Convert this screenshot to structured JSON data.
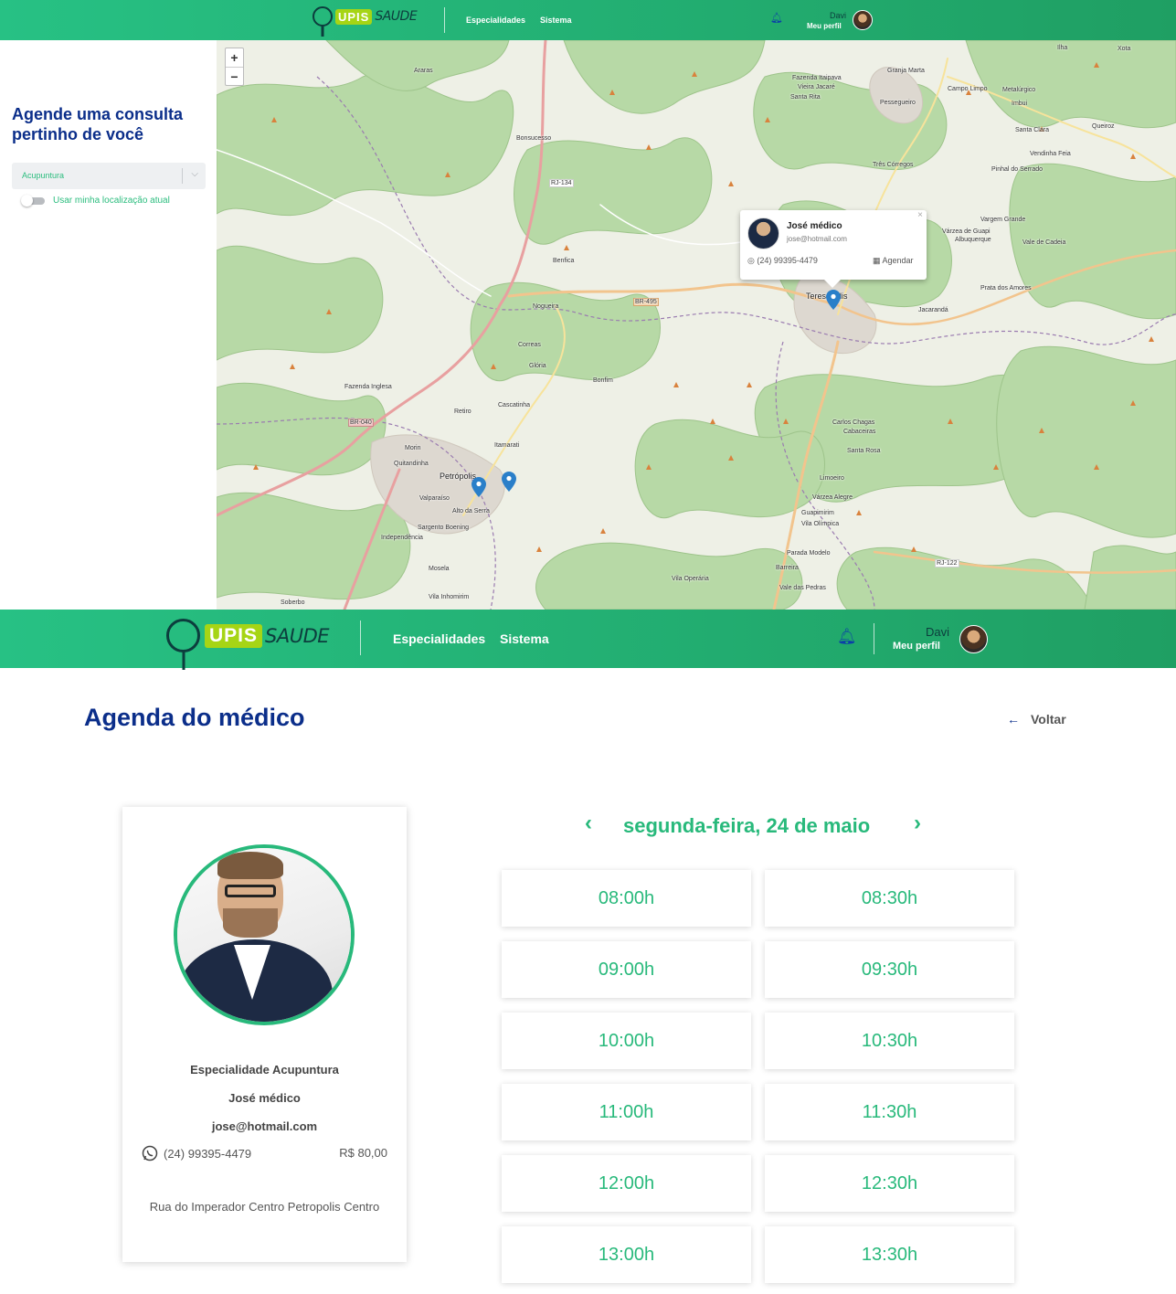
{
  "header_small": {
    "logo_upis": "UPIS",
    "logo_saude": "SAUDE",
    "nav": [
      "Especialidades",
      "Sistema"
    ],
    "user_name": "Davi",
    "user_profile": "Meu perfil"
  },
  "map_sidebar": {
    "title": "Agende uma consulta pertinho de você",
    "specialty_select": "Acupuntura",
    "use_location_label": "Usar minha localização atual"
  },
  "map": {
    "zoom_in": "+",
    "zoom_out": "−",
    "places": [
      "Xota",
      "Granja Marta",
      "Campo Limpo",
      "Vieira Jacaré",
      "Santa Rita",
      "Fazenda Itaipava",
      "Ilha",
      "Metalúrgico",
      "Imbui",
      "Queiroz",
      "Santa Clara",
      "Vendinha Feia",
      "Pinhal do Serrado",
      "Três Córregos",
      "Pessegueiro",
      "Vargem Grande",
      "Várzea de Guapi",
      "Vale de Cadeia",
      "Albuquerque",
      "Jacarandá",
      "Prata dos Amores",
      "Fazenda Inglesa",
      "Araras",
      "Bonsucesso",
      "Benfica",
      "Nogueira",
      "Correas",
      "Glória",
      "Bonfim",
      "Cascatinha",
      "Retiro",
      "Itamarati",
      "Morin",
      "Quitandinha",
      "Independência",
      "Valparaíso",
      "Alto da Serra",
      "Sargento Boening",
      "Mosela",
      "Vila Inhomirim",
      "Soberbo",
      "Carlos Chagas",
      "Santa Rosa",
      "Cabaceiras",
      "Limoeiro",
      "Várzea Alegre",
      "Guapimirim",
      "Vila Olímpica",
      "Parada Modelo",
      "Barreira",
      "Vale das Pedras",
      "Vila Operária"
    ],
    "city_teresopolis": "Teresópolis",
    "city_petropolis": "Petrópolis",
    "road_rj134": "RJ-134",
    "road_br495": "BR-495",
    "road_br040": "BR-040",
    "road_rj122": "RJ-122",
    "popup": {
      "name": "José médico",
      "email": "jose@hotmail.com",
      "phone": "(24) 99395-4479",
      "book": "Agendar",
      "close": "×"
    }
  },
  "header_big": {
    "logo_upis": "UPIS",
    "logo_saude": "SAUDE",
    "nav": [
      "Especialidades",
      "Sistema"
    ],
    "user_name": "Davi",
    "user_profile": "Meu perfil"
  },
  "agenda": {
    "title": "Agenda do médico",
    "back": "Voltar",
    "doctor": {
      "specialty": "Especialidade Acupuntura",
      "name": "José médico",
      "email": "jose@hotmail.com",
      "phone": "(24) 99395-4479",
      "price": "R$ 80,00",
      "address": "Rua do Imperador Centro Petropolis Centro"
    },
    "date_label": "segunda-feira, 24 de maio",
    "prev": "‹",
    "next": "›",
    "slots": [
      "08:00h",
      "08:30h",
      "09:00h",
      "09:30h",
      "10:00h",
      "10:30h",
      "11:00h",
      "11:30h",
      "12:00h",
      "12:30h",
      "13:00h",
      "13:30h"
    ]
  },
  "colors": {
    "brand_green": "#28b97b",
    "brand_blue": "#0b2e8a",
    "header_start": "#27c184",
    "header_end": "#1f9f63"
  }
}
